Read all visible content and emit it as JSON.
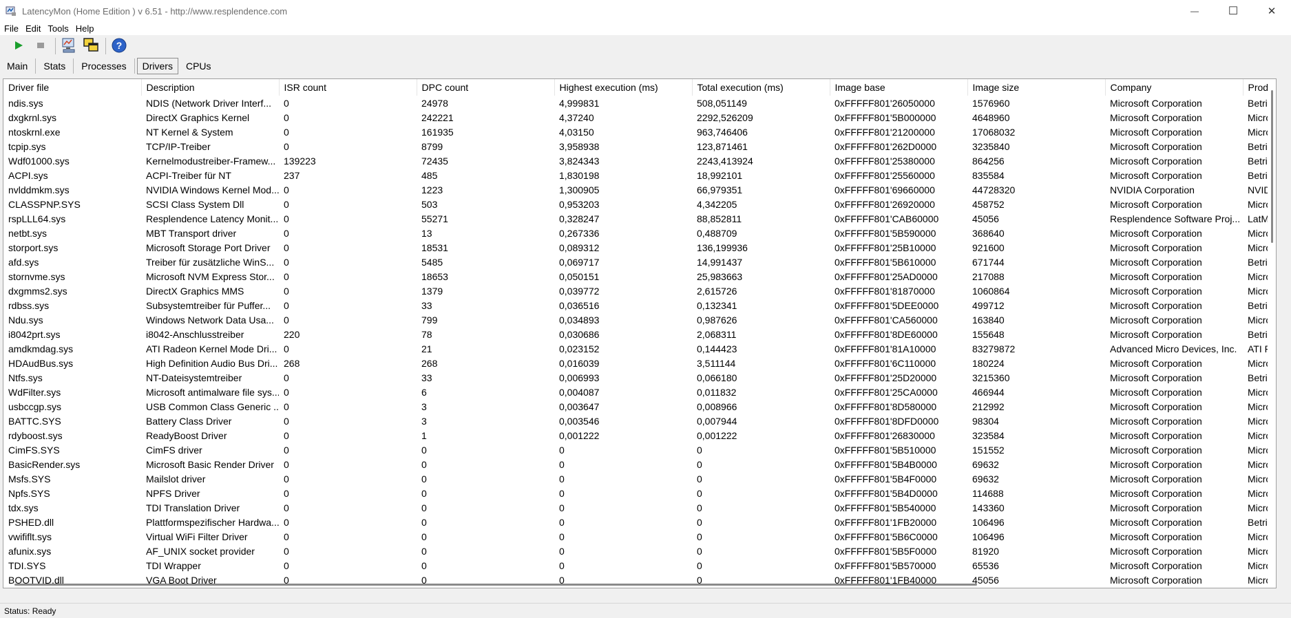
{
  "window": {
    "title": "LatencyMon  (Home Edition )  v 6.51 - http://www.resplendence.com",
    "minimize_glyph": "—",
    "maximize_glyph": "☐",
    "close_glyph": "✕"
  },
  "menu": [
    "File",
    "Edit",
    "Tools",
    "Help"
  ],
  "toolbar": {
    "icons": [
      "play-icon",
      "stop-icon",
      "computer-monitor-icon",
      "window-cascade-icon",
      "help-icon"
    ]
  },
  "tabs": [
    {
      "label": "Main",
      "active": false
    },
    {
      "label": "Stats",
      "active": false
    },
    {
      "label": "Processes",
      "active": false
    },
    {
      "label": "Drivers",
      "active": true
    },
    {
      "label": "CPUs",
      "active": false
    }
  ],
  "table": {
    "columns": [
      "Driver file",
      "Description",
      "ISR count",
      "DPC count",
      "Highest execution (ms)",
      "Total execution (ms)",
      "Image base",
      "Image size",
      "Company",
      "Produ"
    ],
    "rows": [
      [
        "ndis.sys",
        "NDIS (Network Driver Interf...",
        "0",
        "24978",
        "4,999831",
        "508,051149",
        "0xFFFFF801'26050000",
        "1576960",
        "Microsoft Corporation",
        "Betrieb"
      ],
      [
        "dxgkrnl.sys",
        "DirectX Graphics Kernel",
        "0",
        "242221",
        "4,37240",
        "2292,526209",
        "0xFFFFF801'5B000000",
        "4648960",
        "Microsoft Corporation",
        "Micros"
      ],
      [
        "ntoskrnl.exe",
        "NT Kernel & System",
        "0",
        "161935",
        "4,03150",
        "963,746406",
        "0xFFFFF801'21200000",
        "17068032",
        "Microsoft Corporation",
        "Micros"
      ],
      [
        "tcpip.sys",
        "TCP/IP-Treiber",
        "0",
        "8799",
        "3,958938",
        "123,871461",
        "0xFFFFF801'262D0000",
        "3235840",
        "Microsoft Corporation",
        "Betrieb"
      ],
      [
        "Wdf01000.sys",
        "Kernelmodustreiber-Framew...",
        "139223",
        "72435",
        "3,824343",
        "2243,413924",
        "0xFFFFF801'25380000",
        "864256",
        "Microsoft Corporation",
        "Betrieb"
      ],
      [
        "ACPI.sys",
        "ACPI-Treiber für NT",
        "237",
        "485",
        "1,830198",
        "18,992101",
        "0xFFFFF801'25560000",
        "835584",
        "Microsoft Corporation",
        "Betrieb"
      ],
      [
        "nvlddmkm.sys",
        "NVIDIA Windows Kernel Mod...",
        "0",
        "1223",
        "1,300905",
        "66,979351",
        "0xFFFFF801'69660000",
        "44728320",
        "NVIDIA Corporation",
        "NVIDIA"
      ],
      [
        "CLASSPNP.SYS",
        "SCSI Class System Dll",
        "0",
        "503",
        "0,953203",
        "4,342205",
        "0xFFFFF801'26920000",
        "458752",
        "Microsoft Corporation",
        "Micros"
      ],
      [
        "rspLLL64.sys",
        "Resplendence Latency Monit...",
        "0",
        "55271",
        "0,328247",
        "88,852811",
        "0xFFFFF801'CAB60000",
        "45056",
        "Resplendence Software Proj...",
        "LatMo"
      ],
      [
        "netbt.sys",
        "MBT Transport driver",
        "0",
        "13",
        "0,267336",
        "0,488709",
        "0xFFFFF801'5B590000",
        "368640",
        "Microsoft Corporation",
        "Micros"
      ],
      [
        "storport.sys",
        "Microsoft Storage Port Driver",
        "0",
        "18531",
        "0,089312",
        "136,199936",
        "0xFFFFF801'25B10000",
        "921600",
        "Microsoft Corporation",
        "Micros"
      ],
      [
        "afd.sys",
        "Treiber für zusätzliche WinS...",
        "0",
        "5485",
        "0,069717",
        "14,991437",
        "0xFFFFF801'5B610000",
        "671744",
        "Microsoft Corporation",
        "Betrieb"
      ],
      [
        "stornvme.sys",
        "Microsoft NVM Express Stor...",
        "0",
        "18653",
        "0,050151",
        "25,983663",
        "0xFFFFF801'25AD0000",
        "217088",
        "Microsoft Corporation",
        "Micros"
      ],
      [
        "dxgmms2.sys",
        "DirectX Graphics MMS",
        "0",
        "1379",
        "0,039772",
        "2,615726",
        "0xFFFFF801'81870000",
        "1060864",
        "Microsoft Corporation",
        "Micros"
      ],
      [
        "rdbss.sys",
        "Subsystemtreiber für Puffer...",
        "0",
        "33",
        "0,036516",
        "0,132341",
        "0xFFFFF801'5DEE0000",
        "499712",
        "Microsoft Corporation",
        "Betrieb"
      ],
      [
        "Ndu.sys",
        "Windows Network Data Usa...",
        "0",
        "799",
        "0,034893",
        "0,987626",
        "0xFFFFF801'CA560000",
        "163840",
        "Microsoft Corporation",
        "Micros"
      ],
      [
        "i8042prt.sys",
        "i8042-Anschlusstreiber",
        "220",
        "78",
        "0,030686",
        "2,068311",
        "0xFFFFF801'8DE60000",
        "155648",
        "Microsoft Corporation",
        "Betrieb"
      ],
      [
        "amdkmdag.sys",
        "ATI Radeon Kernel Mode Dri...",
        "0",
        "21",
        "0,023152",
        "0,144423",
        "0xFFFFF801'81A10000",
        "83279872",
        "Advanced Micro Devices, Inc.",
        "ATI Ra"
      ],
      [
        "HDAudBus.sys",
        "High Definition Audio Bus Dri...",
        "268",
        "268",
        "0,016039",
        "3,511144",
        "0xFFFFF801'6C110000",
        "180224",
        "Microsoft Corporation",
        "Micros"
      ],
      [
        "Ntfs.sys",
        "NT-Dateisystemtreiber",
        "0",
        "33",
        "0,006993",
        "0,066180",
        "0xFFFFF801'25D20000",
        "3215360",
        "Microsoft Corporation",
        "Betrieb"
      ],
      [
        "WdFilter.sys",
        "Microsoft antimalware file sys...",
        "0",
        "6",
        "0,004087",
        "0,011832",
        "0xFFFFF801'25CA0000",
        "466944",
        "Microsoft Corporation",
        "Micros"
      ],
      [
        "usbccgp.sys",
        "USB Common Class Generic ...",
        "0",
        "3",
        "0,003647",
        "0,008966",
        "0xFFFFF801'8D580000",
        "212992",
        "Microsoft Corporation",
        "Micros"
      ],
      [
        "BATTC.SYS",
        "Battery Class Driver",
        "0",
        "3",
        "0,003546",
        "0,007944",
        "0xFFFFF801'8DFD0000",
        "98304",
        "Microsoft Corporation",
        "Micros"
      ],
      [
        "rdyboost.sys",
        "ReadyBoost Driver",
        "0",
        "1",
        "0,001222",
        "0,001222",
        "0xFFFFF801'26830000",
        "323584",
        "Microsoft Corporation",
        "Micros"
      ],
      [
        "CimFS.SYS",
        "CimFS driver",
        "0",
        "0",
        "0",
        "0",
        "0xFFFFF801'5B510000",
        "151552",
        "Microsoft Corporation",
        "Micros"
      ],
      [
        "BasicRender.sys",
        "Microsoft Basic Render Driver",
        "0",
        "0",
        "0",
        "0",
        "0xFFFFF801'5B4B0000",
        "69632",
        "Microsoft Corporation",
        "Micros"
      ],
      [
        "Msfs.SYS",
        "Mailslot driver",
        "0",
        "0",
        "0",
        "0",
        "0xFFFFF801'5B4F0000",
        "69632",
        "Microsoft Corporation",
        "Micros"
      ],
      [
        "Npfs.SYS",
        "NPFS Driver",
        "0",
        "0",
        "0",
        "0",
        "0xFFFFF801'5B4D0000",
        "114688",
        "Microsoft Corporation",
        "Micros"
      ],
      [
        "tdx.sys",
        "TDI Translation Driver",
        "0",
        "0",
        "0",
        "0",
        "0xFFFFF801'5B540000",
        "143360",
        "Microsoft Corporation",
        "Micros"
      ],
      [
        "PSHED.dll",
        "Plattformspezifischer Hardwa...",
        "0",
        "0",
        "0",
        "0",
        "0xFFFFF801'1FB20000",
        "106496",
        "Microsoft Corporation",
        "Betrieb"
      ],
      [
        "vwififlt.sys",
        "Virtual WiFi Filter Driver",
        "0",
        "0",
        "0",
        "0",
        "0xFFFFF801'5B6C0000",
        "106496",
        "Microsoft Corporation",
        "Micros"
      ],
      [
        "afunix.sys",
        "AF_UNIX socket provider",
        "0",
        "0",
        "0",
        "0",
        "0xFFFFF801'5B5F0000",
        "81920",
        "Microsoft Corporation",
        "Micros"
      ],
      [
        "TDI.SYS",
        "TDI Wrapper",
        "0",
        "0",
        "0",
        "0",
        "0xFFFFF801'5B570000",
        "65536",
        "Microsoft Corporation",
        "Micros"
      ],
      [
        "BOOTVID.dll",
        "VGA Boot Driver",
        "0",
        "0",
        "0",
        "0",
        "0xFFFFF801'1FB40000",
        "45056",
        "Microsoft Corporation",
        "Micros"
      ]
    ]
  },
  "status": "Status: Ready"
}
